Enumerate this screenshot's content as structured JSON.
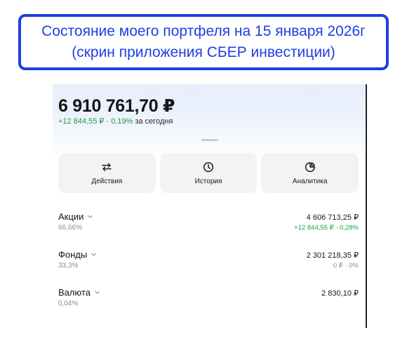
{
  "caption": {
    "line1": "Состояние моего портфеля на 15 января 2026г",
    "line2": "(скрин приложения СБЕР инвестиции)"
  },
  "portfolio": {
    "total": "6 910 761,70 ₽",
    "change_amount": "+12 844,55 ₽",
    "change_sep": " · ",
    "change_percent": "0,19%",
    "change_period": "за сегодня"
  },
  "actions": [
    {
      "label": "Действия",
      "icon": "swap-arrows-icon"
    },
    {
      "label": "История",
      "icon": "clock-icon"
    },
    {
      "label": "Аналитика",
      "icon": "pie-chart-icon"
    }
  ],
  "holdings": [
    {
      "name": "Акции",
      "share": "66,66%",
      "amount": "4 606 713,25 ₽",
      "change": "+12 844,55 ₽ · 0,28%"
    },
    {
      "name": "Фонды",
      "share": "33,3%",
      "amount": "2 301 218,35 ₽",
      "change": "0 ₽ · 0%"
    },
    {
      "name": "Валюта",
      "share": "0,04%",
      "amount": "2 830,10 ₽",
      "change": ""
    }
  ],
  "colors": {
    "caption": "#1f3fe0",
    "positive": "#1f9a48",
    "muted": "#8a8d93"
  }
}
